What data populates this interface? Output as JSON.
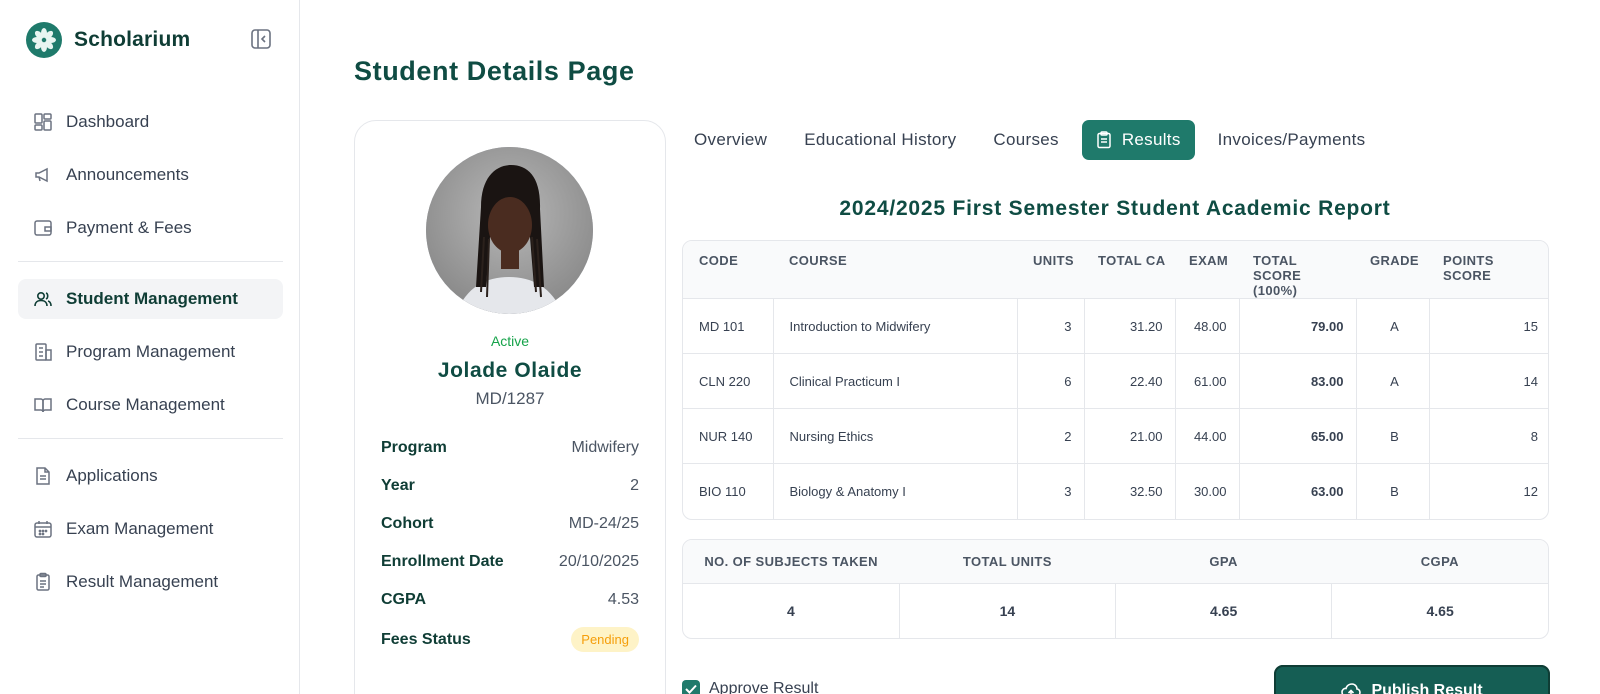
{
  "brand": {
    "name": "Scholarium"
  },
  "sidebar": {
    "items": [
      {
        "label": "Dashboard",
        "icon": "dashboard-icon"
      },
      {
        "label": "Announcements",
        "icon": "megaphone-icon"
      },
      {
        "label": "Payment & Fees",
        "icon": "wallet-icon"
      },
      {
        "label": "Student Management",
        "icon": "users-icon",
        "active": true
      },
      {
        "label": "Program Management",
        "icon": "building-icon"
      },
      {
        "label": "Course Management",
        "icon": "book-icon"
      },
      {
        "label": "Applications",
        "icon": "document-icon"
      },
      {
        "label": "Exam Management",
        "icon": "calendar-icon"
      },
      {
        "label": "Result Management",
        "icon": "clipboard-icon"
      }
    ]
  },
  "page": {
    "title": "Student Details Page"
  },
  "profile": {
    "status": "Active",
    "name": "Jolade Olaide",
    "id": "MD/1287",
    "details": [
      {
        "label": "Program",
        "value": "Midwifery"
      },
      {
        "label": "Year",
        "value": "2"
      },
      {
        "label": "Cohort",
        "value": "MD-24/25"
      },
      {
        "label": "Enrollment Date",
        "value": "20/10/2025"
      },
      {
        "label": "CGPA",
        "value": "4.53"
      },
      {
        "label": "Fees Status",
        "value": "Pending"
      }
    ]
  },
  "tabs": [
    {
      "label": "Overview"
    },
    {
      "label": "Educational History"
    },
    {
      "label": "Courses"
    },
    {
      "label": "Results",
      "active": true
    },
    {
      "label": "Invoices/Payments"
    }
  ],
  "report": {
    "title": "2024/2025 First Semester Student Academic Report",
    "headers": [
      "CODE",
      "COURSE",
      "UNITS",
      "TOTAL CA",
      "EXAM",
      "TOTAL SCORE (100%)",
      "GRADE",
      "POINTS SCORE"
    ],
    "rows": [
      [
        "MD 101",
        "Introduction to Midwifery",
        "3",
        "31.20",
        "48.00",
        "79.00",
        "A",
        "15"
      ],
      [
        "CLN 220",
        "Clinical Practicum I",
        "6",
        "22.40",
        "61.00",
        "83.00",
        "A",
        "14"
      ],
      [
        "NUR 140",
        "Nursing Ethics",
        "2",
        "21.00",
        "44.00",
        "65.00",
        "B",
        "8"
      ],
      [
        "BIO 110",
        "Biology & Anatomy I",
        "3",
        "32.50",
        "30.00",
        "63.00",
        "B",
        "12"
      ]
    ]
  },
  "summary": {
    "headers": [
      "NO. OF SUBJECTS TAKEN",
      "TOTAL UNITS",
      "GPA",
      "CGPA"
    ],
    "values": [
      "4",
      "14",
      "4.65",
      "4.65"
    ]
  },
  "actions": {
    "approve_label": "Approve Result",
    "approve_checked": true,
    "publish_label": "Publish Result"
  },
  "colors": {
    "accent": "#1f7a6b",
    "primary_text": "#0f4c43",
    "active_status": "#16a34a",
    "pending_bg": "#fef3c7",
    "pending_text": "#f59e0b"
  }
}
